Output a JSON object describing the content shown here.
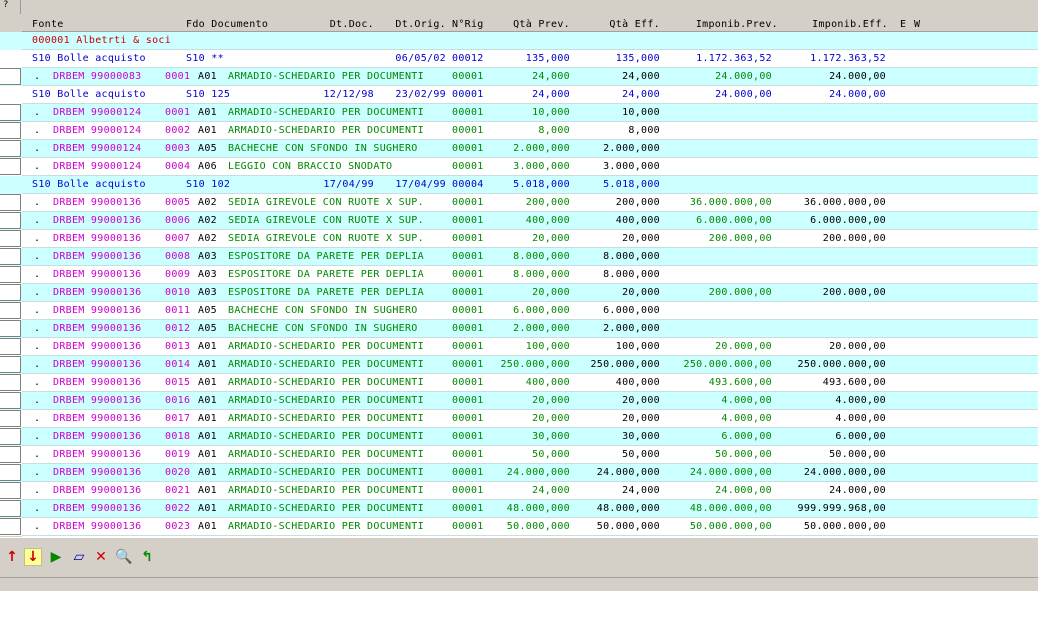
{
  "corner_label": "?",
  "headers": {
    "fonte": "Fonte",
    "fdo_documento": "Fdo Documento",
    "dt_doc": "Dt.Doc.",
    "dt_orig": "Dt.Orig.",
    "nrig": "N°Rig",
    "qta_prev": "Qtà Prev.",
    "qta_eff": "Qtà Eff.",
    "imponib_prev": "Imponib.Prev.",
    "imponib_eff": "Imponib.Eff.",
    "e": "E",
    "w": "W"
  },
  "rows": [
    {
      "type": "supplier",
      "bg": "cyan",
      "text": "000001 Albetrti & soci"
    },
    {
      "type": "doc",
      "bg": "white",
      "fonte": "S10 Bolle acquisto",
      "fdo": "S10 **",
      "dt_doc": "",
      "dt_orig": "06/05/02",
      "nrig": "00012",
      "qta_prev": "135,000",
      "qta_eff": "135,000",
      "imp_prev": "1.172.363,52",
      "imp_eff": "1.172.363,52"
    },
    {
      "type": "line",
      "bg": "cyan",
      "code": "DRBEM 99000083",
      "num": "0001",
      "art": "A01",
      "desc": "ARMADIO-SCHEDARIO PER DOCUMENTI",
      "nrig": "00001",
      "qta_prev": "24,000",
      "qta_eff": "24,000",
      "imp_prev": "24.000,00",
      "imp_eff": "24.000,00"
    },
    {
      "type": "doc",
      "bg": "white",
      "fonte": "S10 Bolle acquisto",
      "fdo": "S10 125",
      "dt_doc": "12/12/98",
      "dt_orig": "23/02/99",
      "nrig": "00001",
      "qta_prev": "24,000",
      "qta_eff": "24,000",
      "imp_prev": "24.000,00",
      "imp_eff": "24.000,00"
    },
    {
      "type": "line",
      "bg": "cyan",
      "code": "DRBEM 99000124",
      "num": "0001",
      "art": "A01",
      "desc": "ARMADIO-SCHEDARIO PER DOCUMENTI",
      "nrig": "00001",
      "qta_prev": "10,000",
      "qta_eff": "10,000",
      "imp_prev": "",
      "imp_eff": ""
    },
    {
      "type": "line",
      "bg": "white",
      "code": "DRBEM 99000124",
      "num": "0002",
      "art": "A01",
      "desc": "ARMADIO-SCHEDARIO PER DOCUMENTI",
      "nrig": "00001",
      "qta_prev": "8,000",
      "qta_eff": "8,000",
      "imp_prev": "",
      "imp_eff": ""
    },
    {
      "type": "line",
      "bg": "cyan",
      "code": "DRBEM 99000124",
      "num": "0003",
      "art": "A05",
      "desc": "BACHECHE CON SFONDO IN SUGHERO",
      "nrig": "00001",
      "qta_prev": "2.000,000",
      "qta_eff": "2.000,000",
      "imp_prev": "",
      "imp_eff": ""
    },
    {
      "type": "line",
      "bg": "white",
      "code": "DRBEM 99000124",
      "num": "0004",
      "art": "A06",
      "desc": "LEGGIO CON BRACCIO SNODATO",
      "nrig": "00001",
      "qta_prev": "3.000,000",
      "qta_eff": "3.000,000",
      "imp_prev": "",
      "imp_eff": ""
    },
    {
      "type": "doc",
      "bg": "cyan",
      "fonte": "S10 Bolle acquisto",
      "fdo": "S10 102",
      "dt_doc": "17/04/99",
      "dt_orig": "17/04/99",
      "nrig": "00004",
      "qta_prev": "5.018,000",
      "qta_eff": "5.018,000",
      "imp_prev": "",
      "imp_eff": ""
    },
    {
      "type": "line",
      "bg": "white",
      "code": "DRBEM 99000136",
      "num": "0005",
      "art": "A02",
      "desc": "SEDIA GIREVOLE CON RUOTE X SUP.",
      "nrig": "00001",
      "qta_prev": "200,000",
      "qta_eff": "200,000",
      "imp_prev": "36.000.000,00",
      "imp_eff": "36.000.000,00"
    },
    {
      "type": "line",
      "bg": "cyan",
      "code": "DRBEM 99000136",
      "num": "0006",
      "art": "A02",
      "desc": "SEDIA GIREVOLE CON RUOTE X SUP.",
      "nrig": "00001",
      "qta_prev": "400,000",
      "qta_eff": "400,000",
      "imp_prev": "6.000.000,00",
      "imp_eff": "6.000.000,00"
    },
    {
      "type": "line",
      "bg": "white",
      "code": "DRBEM 99000136",
      "num": "0007",
      "art": "A02",
      "desc": "SEDIA GIREVOLE CON RUOTE X SUP.",
      "nrig": "00001",
      "qta_prev": "20,000",
      "qta_eff": "20,000",
      "imp_prev": "200.000,00",
      "imp_eff": "200.000,00"
    },
    {
      "type": "line",
      "bg": "cyan",
      "code": "DRBEM 99000136",
      "num": "0008",
      "art": "A03",
      "desc": "ESPOSITORE DA PARETE PER DEPLIA",
      "nrig": "00001",
      "qta_prev": "8.000,000",
      "qta_eff": "8.000,000",
      "imp_prev": "",
      "imp_eff": ""
    },
    {
      "type": "line",
      "bg": "white",
      "code": "DRBEM 99000136",
      "num": "0009",
      "art": "A03",
      "desc": "ESPOSITORE DA PARETE PER DEPLIA",
      "nrig": "00001",
      "qta_prev": "8.000,000",
      "qta_eff": "8.000,000",
      "imp_prev": "",
      "imp_eff": ""
    },
    {
      "type": "line",
      "bg": "cyan",
      "code": "DRBEM 99000136",
      "num": "0010",
      "art": "A03",
      "desc": "ESPOSITORE DA PARETE PER DEPLIA",
      "nrig": "00001",
      "qta_prev": "20,000",
      "qta_eff": "20,000",
      "imp_prev": "200.000,00",
      "imp_eff": "200.000,00"
    },
    {
      "type": "line",
      "bg": "white",
      "code": "DRBEM 99000136",
      "num": "0011",
      "art": "A05",
      "desc": "BACHECHE CON SFONDO IN SUGHERO",
      "nrig": "00001",
      "qta_prev": "6.000,000",
      "qta_eff": "6.000,000",
      "imp_prev": "",
      "imp_eff": ""
    },
    {
      "type": "line",
      "bg": "cyan",
      "code": "DRBEM 99000136",
      "num": "0012",
      "art": "A05",
      "desc": "BACHECHE CON SFONDO IN SUGHERO",
      "nrig": "00001",
      "qta_prev": "2.000,000",
      "qta_eff": "2.000,000",
      "imp_prev": "",
      "imp_eff": ""
    },
    {
      "type": "line",
      "bg": "white",
      "code": "DRBEM 99000136",
      "num": "0013",
      "art": "A01",
      "desc": "ARMADIO-SCHEDARIO PER DOCUMENTI",
      "nrig": "00001",
      "qta_prev": "100,000",
      "qta_eff": "100,000",
      "imp_prev": "20.000,00",
      "imp_eff": "20.000,00"
    },
    {
      "type": "line",
      "bg": "cyan",
      "code": "DRBEM 99000136",
      "num": "0014",
      "art": "A01",
      "desc": "ARMADIO-SCHEDARIO PER DOCUMENTI",
      "nrig": "00001",
      "qta_prev": "250.000,000",
      "qta_eff": "250.000,000",
      "imp_prev": "250.000.000,00",
      "imp_eff": "250.000.000,00"
    },
    {
      "type": "line",
      "bg": "white",
      "code": "DRBEM 99000136",
      "num": "0015",
      "art": "A01",
      "desc": "ARMADIO-SCHEDARIO PER DOCUMENTI",
      "nrig": "00001",
      "qta_prev": "400,000",
      "qta_eff": "400,000",
      "imp_prev": "493.600,00",
      "imp_eff": "493.600,00"
    },
    {
      "type": "line",
      "bg": "cyan",
      "code": "DRBEM 99000136",
      "num": "0016",
      "art": "A01",
      "desc": "ARMADIO-SCHEDARIO PER DOCUMENTI",
      "nrig": "00001",
      "qta_prev": "20,000",
      "qta_eff": "20,000",
      "imp_prev": "4.000,00",
      "imp_eff": "4.000,00"
    },
    {
      "type": "line",
      "bg": "white",
      "code": "DRBEM 99000136",
      "num": "0017",
      "art": "A01",
      "desc": "ARMADIO-SCHEDARIO PER DOCUMENTI",
      "nrig": "00001",
      "qta_prev": "20,000",
      "qta_eff": "20,000",
      "imp_prev": "4.000,00",
      "imp_eff": "4.000,00"
    },
    {
      "type": "line",
      "bg": "cyan",
      "code": "DRBEM 99000136",
      "num": "0018",
      "art": "A01",
      "desc": "ARMADIO-SCHEDARIO PER DOCUMENTI",
      "nrig": "00001",
      "qta_prev": "30,000",
      "qta_eff": "30,000",
      "imp_prev": "6.000,00",
      "imp_eff": "6.000,00"
    },
    {
      "type": "line",
      "bg": "white",
      "code": "DRBEM 99000136",
      "num": "0019",
      "art": "A01",
      "desc": "ARMADIO-SCHEDARIO PER DOCUMENTI",
      "nrig": "00001",
      "qta_prev": "50,000",
      "qta_eff": "50,000",
      "imp_prev": "50.000,00",
      "imp_eff": "50.000,00"
    },
    {
      "type": "line",
      "bg": "cyan",
      "code": "DRBEM 99000136",
      "num": "0020",
      "art": "A01",
      "desc": "ARMADIO-SCHEDARIO PER DOCUMENTI",
      "nrig": "00001",
      "qta_prev": "24.000,000",
      "qta_eff": "24.000,000",
      "imp_prev": "24.000.000,00",
      "imp_eff": "24.000.000,00"
    },
    {
      "type": "line",
      "bg": "white",
      "code": "DRBEM 99000136",
      "num": "0021",
      "art": "A01",
      "desc": "ARMADIO-SCHEDARIO PER DOCUMENTI",
      "nrig": "00001",
      "qta_prev": "24,000",
      "qta_eff": "24,000",
      "imp_prev": "24.000,00",
      "imp_eff": "24.000,00"
    },
    {
      "type": "line",
      "bg": "cyan",
      "code": "DRBEM 99000136",
      "num": "0022",
      "art": "A01",
      "desc": "ARMADIO-SCHEDARIO PER DOCUMENTI",
      "nrig": "00001",
      "qta_prev": "48.000,000",
      "qta_eff": "48.000,000",
      "imp_prev": "48.000.000,00",
      "imp_eff": "999.999.968,00"
    },
    {
      "type": "line",
      "bg": "white",
      "code": "DRBEM 99000136",
      "num": "0023",
      "art": "A01",
      "desc": "ARMADIO-SCHEDARIO PER DOCUMENTI",
      "nrig": "00001",
      "qta_prev": "50.000,000",
      "qta_eff": "50.000,000",
      "imp_prev": "50.000.000,00",
      "imp_eff": "50.000.000,00"
    }
  ],
  "toolbar": [
    {
      "name": "arrow-up-icon",
      "glyph": "↑",
      "color": "#cc0000",
      "active": false
    },
    {
      "name": "arrow-down-icon",
      "glyph": "↓",
      "color": "#cc0000",
      "active": true
    },
    {
      "name": "play-icon",
      "glyph": "▶",
      "color": "#008800",
      "active": false
    },
    {
      "name": "eraser-icon",
      "glyph": "▱",
      "color": "#0000aa",
      "active": false
    },
    {
      "name": "delete-icon",
      "glyph": "✕",
      "color": "#cc0000",
      "active": false
    },
    {
      "name": "search-icon",
      "glyph": "🔍",
      "color": "#000088",
      "active": false
    },
    {
      "name": "refresh-icon",
      "glyph": "↰",
      "color": "#008800",
      "active": false
    }
  ],
  "colors": {
    "grid_cyan": "#ccffff",
    "supplier": "#cc0000",
    "document": "#0000cc",
    "code": "#cc00cc",
    "desc": "#008800",
    "qty": "#000000"
  }
}
